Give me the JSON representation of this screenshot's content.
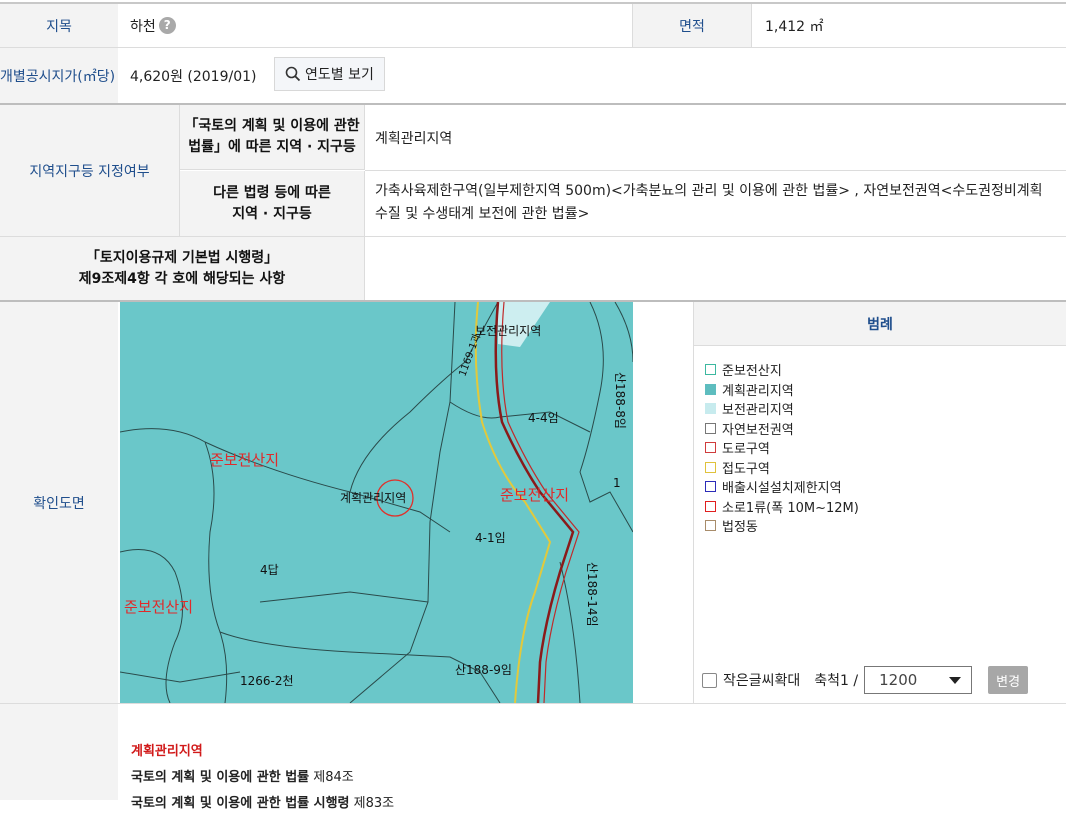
{
  "row1": {
    "label_jimok": "지목",
    "value_jimok": "하천",
    "help": "?",
    "label_area": "면적",
    "value_area": "1,412 ㎡"
  },
  "row2": {
    "label_price": "개별공시지가(㎡당)",
    "value_price": "4,620원 (2019/01)",
    "btn_year": "연도별 보기"
  },
  "zone": {
    "label": "지역지구등 지정여부",
    "sub1_label": "「국토의 계획 및 이용에 관한 법률」에 따른 지역 · 지구등",
    "sub1_label_l1": "「국토의 계획 및 이용에 관한",
    "sub1_label_l2": "법률」에 따른 지역 · 지구등",
    "sub1_value": "계획관리지역",
    "sub2_label_l1": "다른 법령 등에 따른",
    "sub2_label_l2": "지역 · 지구등",
    "sub2_value_l1": "가축사육제한구역(일부제한지역 500m)<가축분뇨의 관리 및 이용에 관한 법률> , 자연보전권역<수도권정비계획",
    "sub2_value_l2": "수질 및 수생태계 보전에 관한 법률>"
  },
  "decree": {
    "label_l1": "「토지이용규제 기본법 시행령」",
    "label_l2": "제9조제4항 각 호에 해당되는 사항",
    "value": ""
  },
  "map_section": {
    "label": "확인도면",
    "legend_title": "범례",
    "legend": [
      {
        "name": "준보전산지",
        "color": "#3cb8a0",
        "filled": false
      },
      {
        "name": "계획관리지역",
        "color": "#5ebdbf",
        "filled": true
      },
      {
        "name": "보전관리지역",
        "color": "#c7ebee",
        "filled": true
      },
      {
        "name": "자연보전권역",
        "color": "#777777",
        "filled": false
      },
      {
        "name": "도로구역",
        "color": "#d03c3c",
        "filled": false
      },
      {
        "name": "접도구역",
        "color": "#e0c23c",
        "filled": false
      },
      {
        "name": "배출시설설치제한지역",
        "color": "#2c2cb8",
        "filled": false
      },
      {
        "name": "소로1류(폭 10M~12M)",
        "color": "#e01f1f",
        "filled": false
      },
      {
        "name": "법정동",
        "color": "#a88c6a",
        "filled": false
      }
    ],
    "small_text_label": "작은글씨확대",
    "scale_label": "축척1 /",
    "scale_value": "1200",
    "change_btn": "변경"
  },
  "map_labels": {
    "boje": "보전관리지역",
    "jun1": "준보전산지",
    "jun2": "준보전산지",
    "jun3": "준보전산지",
    "gyehoek": "계획관리지역",
    "p44": "4-4임",
    "p41": "4-1임",
    "p4": "4답",
    "p1266": "1266-2천",
    "p1889": "산188-9임",
    "p1888": "산188-8임",
    "p18814": "산188-14임",
    "p1169": "1169-1과",
    "p1": "1"
  },
  "bottom": {
    "heading": "계획관리지역",
    "law1": "국토의 계획 및 이용에 관한 법률",
    "law1_suffix": " 제84조",
    "law2": "국토의 계획 및 이용에 관한 법률 시행령",
    "law2_suffix": " 제83조"
  }
}
